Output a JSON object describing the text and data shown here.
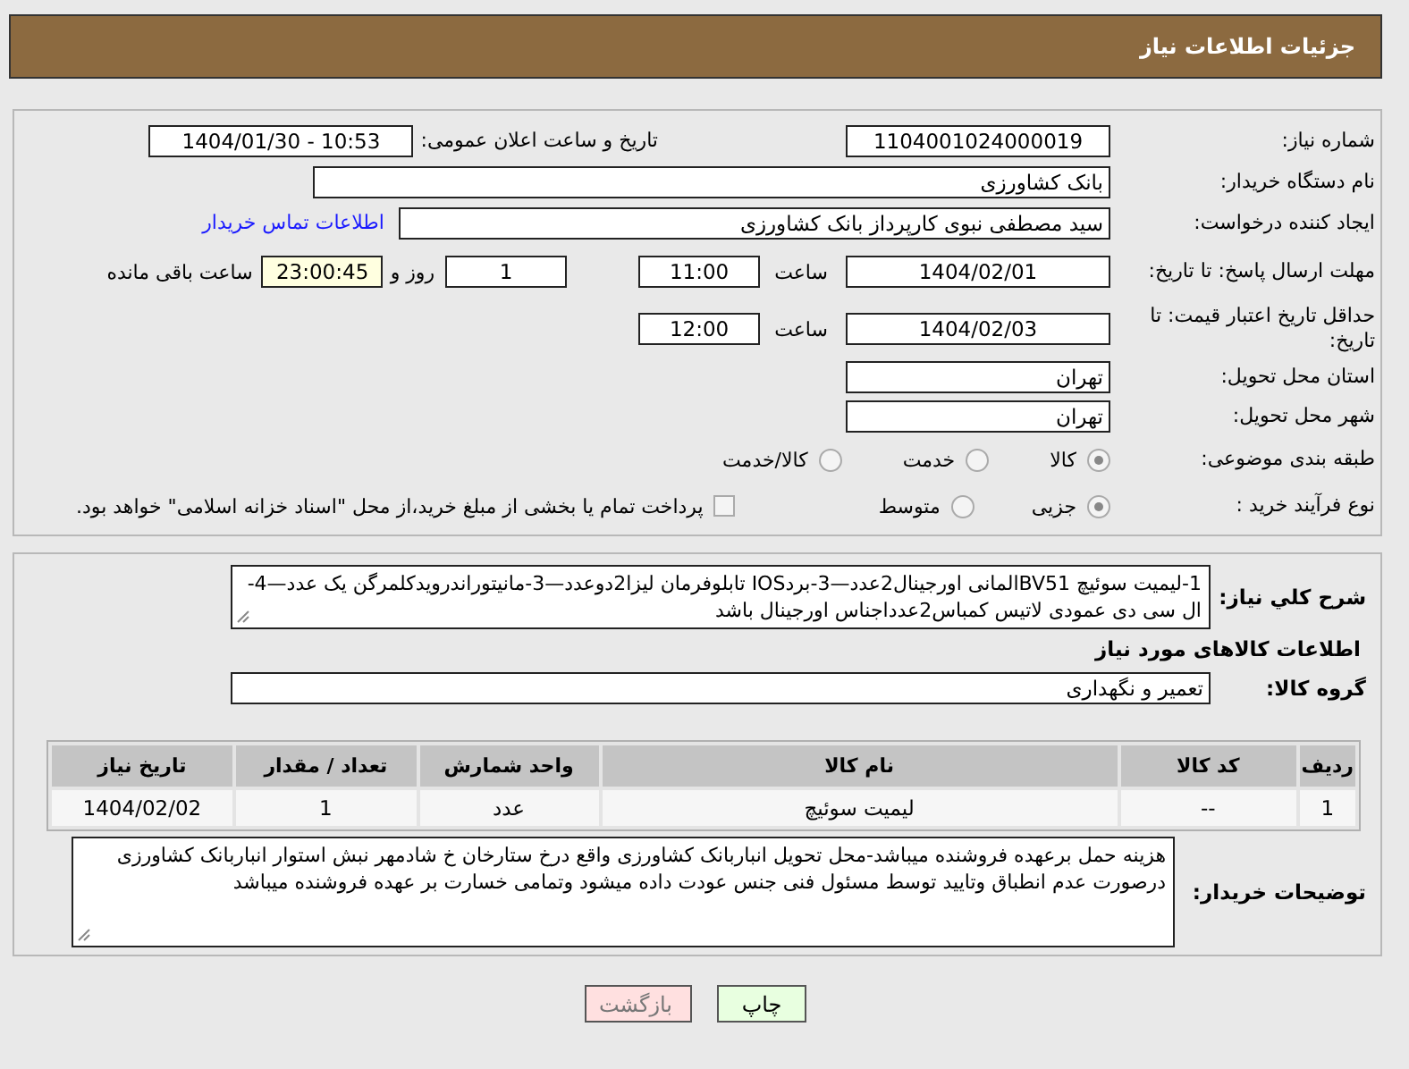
{
  "header": {
    "title": "جزئیات اطلاعات نیاز"
  },
  "need_number": {
    "label": "شماره نیاز:",
    "value": "1104001024000019"
  },
  "announce": {
    "label": "تاریخ و ساعت اعلان عمومی:",
    "value": "1404/01/30 - 10:53"
  },
  "buyer_org": {
    "label": "نام دستگاه خریدار:",
    "value": "بانک کشاورزی"
  },
  "requester": {
    "label": "ایجاد کننده درخواست:",
    "value": "سید مصطفی نبوی کارپرداز بانک کشاورزی",
    "contact_link": "اطلاعات تماس خریدار"
  },
  "response_deadline": {
    "label": "مهلت ارسال پاسخ: تا تاریخ:",
    "date": "1404/02/01",
    "time_label": "ساعت",
    "time": "11:00",
    "days": "1",
    "days_label": "روز و",
    "remaining": "23:00:45",
    "remaining_label": "ساعت باقی مانده"
  },
  "price_validity": {
    "label": "حداقل تاریخ اعتبار قیمت: تا تاریخ:",
    "date": "1404/02/03",
    "time_label": "ساعت",
    "time": "12:00"
  },
  "province": {
    "label": "استان محل تحویل:",
    "value": "تهران"
  },
  "city": {
    "label": "شهر محل تحویل:",
    "value": "تهران"
  },
  "category": {
    "label": "طبقه بندی موضوعی:",
    "options": [
      {
        "label": "کالا",
        "selected": true
      },
      {
        "label": "خدمت",
        "selected": false
      },
      {
        "label": "کالا/خدمت",
        "selected": false
      }
    ]
  },
  "process": {
    "label": "نوع فرآیند خرید :",
    "options": [
      {
        "label": "جزیی",
        "selected": true
      },
      {
        "label": "متوسط",
        "selected": false
      }
    ],
    "payment": {
      "label": "پرداخت تمام یا بخشی از مبلغ خرید،از محل \"اسناد خزانه اسلامی\" خواهد بود.",
      "checked": false
    }
  },
  "description": {
    "label": "شرح کلي نياز:",
    "value": "1-ليميت سوئيچ BV51المانی اورجينال2عدد—3-بردIOS تابلوفرمان ليزا2دوعدد—3-مانيتوراندرويدكلمرگن يک عدد—4-ال سی دی عمودی لاتيس كمباس2عدداجناس اورجينال باشد"
  },
  "items_title": "اطلاعات کالاهای مورد نیاز",
  "goods_group": {
    "label": "گروه کالا:",
    "value": "تعمیر و نگهداری"
  },
  "table": {
    "columns": [
      "ردیف",
      "کد کالا",
      "نام کالا",
      "واحد شمارش",
      "تعداد / مقدار",
      "تاریخ نیاز"
    ],
    "rows": [
      [
        "1",
        "--",
        "لیمیت سوئیچ",
        "عدد",
        "1",
        "1404/02/02"
      ]
    ]
  },
  "buyer_notes": {
    "label": "توضیحات خریدار:",
    "value": "هزینه حمل برعهده فروشنده میباشد-محل تحویل انباربانک کشاورزی واقع درخ ستارخان خ شادمهر نبش استوار انباربانک کشاورزی درصورت عدم انطباق وتایید توسط مسئول فنی جنس عودت داده میشود وتمامی خسارت بر عهده فروشنده میباشد"
  },
  "buttons": [
    {
      "label": "چاپ",
      "kind": "print"
    },
    {
      "label": "بازگشت",
      "kind": "back"
    }
  ]
}
